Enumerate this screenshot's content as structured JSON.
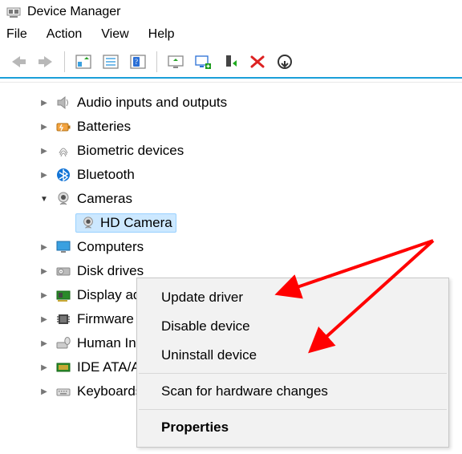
{
  "window": {
    "title": "Device Manager"
  },
  "menubar": {
    "items": [
      "File",
      "Action",
      "View",
      "Help"
    ]
  },
  "toolbar": {
    "icons": [
      "nav-back",
      "nav-forward",
      "sep",
      "show-hidden",
      "properties-list",
      "help",
      "sep",
      "scan",
      "monitor-plus",
      "eject-green",
      "delete-red",
      "update-circle"
    ]
  },
  "tree": {
    "nodes": [
      {
        "expand": "collapsed",
        "icon": "speaker",
        "label": "Audio inputs and outputs"
      },
      {
        "expand": "collapsed",
        "icon": "battery",
        "label": "Batteries"
      },
      {
        "expand": "collapsed",
        "icon": "fingerprint",
        "label": "Biometric devices"
      },
      {
        "expand": "collapsed",
        "icon": "bluetooth",
        "label": "Bluetooth"
      },
      {
        "expand": "expanded",
        "icon": "camera",
        "label": "Cameras",
        "children": [
          {
            "icon": "camera",
            "label": "HD Camera",
            "selected": true
          }
        ]
      },
      {
        "expand": "collapsed",
        "icon": "monitor",
        "label": "Computers"
      },
      {
        "expand": "collapsed",
        "icon": "disk",
        "label": "Disk drives"
      },
      {
        "expand": "collapsed",
        "icon": "display-adapter",
        "label": "Display adapters"
      },
      {
        "expand": "collapsed",
        "icon": "chip",
        "label": "Firmware"
      },
      {
        "expand": "collapsed",
        "icon": "keyboard-mouse",
        "label": "Human Interface Devices"
      },
      {
        "expand": "collapsed",
        "icon": "ide",
        "label": "IDE ATA/ATAPI controllers"
      },
      {
        "expand": "collapsed",
        "icon": "keyboard",
        "label": "Keyboards"
      }
    ]
  },
  "context_menu": {
    "items": [
      {
        "label": "Update driver",
        "type": "item"
      },
      {
        "label": "Disable device",
        "type": "item"
      },
      {
        "label": "Uninstall device",
        "type": "item"
      },
      {
        "type": "sep"
      },
      {
        "label": "Scan for hardware changes",
        "type": "item"
      },
      {
        "type": "sep"
      },
      {
        "label": "Properties",
        "type": "item",
        "bold": true
      }
    ]
  }
}
